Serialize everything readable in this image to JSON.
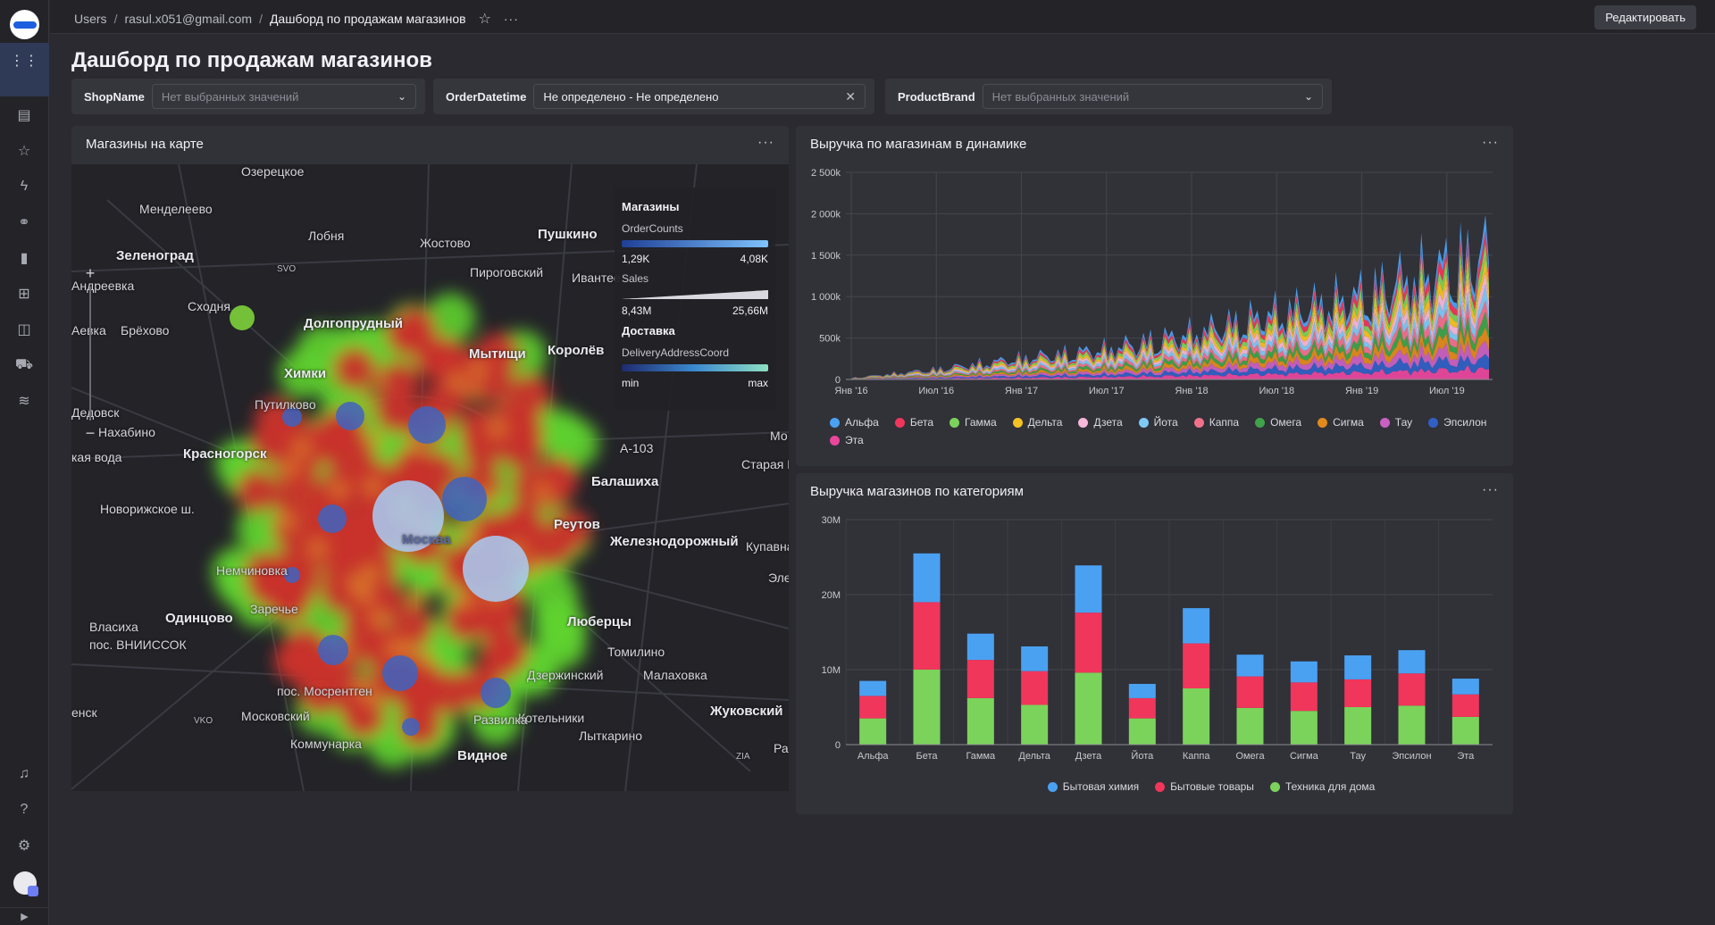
{
  "breadcrumbs": [
    "Users",
    "rasul.x051@gmail.com",
    "Дашборд по продажам магазинов"
  ],
  "edit_button": "Редактировать",
  "page_title": "Дашборд по продажам магазинов",
  "filters": [
    {
      "label": "ShopName",
      "value": "Нет выбранных значений",
      "filled": false,
      "control": "chevron"
    },
    {
      "label": "OrderDatetime",
      "value": "Не определено - Не определено",
      "filled": true,
      "control": "clear"
    },
    {
      "label": "ProductBrand",
      "value": "Нет выбранных значений",
      "filled": false,
      "control": "chevron"
    }
  ],
  "map_widget": {
    "title": "Магазины на карте",
    "labels": [
      "Озерецкое",
      "Менделеево",
      "Лобня",
      "Жостово",
      "Пушкино",
      "Зеленоград",
      "Пирогов­ский",
      "Ивантее",
      "Андреевка",
      "SVO",
      "Сходня",
      "Долгопрудный",
      "Брёхово",
      "Мытищи",
      "Королёв",
      "Химки",
      "Путилково",
      "Дедовск",
      "Нахабино",
      "Красногорск",
      "Балашиха",
      "Старая К",
      "Мо",
      "A-103",
      "Реутов",
      "Железнодорожный",
      "Купавна",
      "Эле",
      "Новорижское ш.",
      "Немчиновка",
      "Заречье",
      "Одинцово",
      "Люберцы",
      "Власиха",
      "пос. ВНИИССОК",
      "Томилино",
      "Малаховка",
      "Дзержинский",
      "пос. Мосрентген",
      "Котельники",
      "Московский",
      "VKO",
      "Жуковский",
      "Развилка",
      "Лыткарино",
      "Коммунарка",
      "Видное",
      "ZIA",
      "Ра",
      "енск",
      "Аевка",
      "кая вода",
      "Москва"
    ],
    "legend": {
      "title1": "Магазины",
      "metric1": "OrderCounts",
      "range1": [
        "1,29K",
        "4,08K"
      ],
      "metric2": "Sales",
      "range2": [
        "8,43M",
        "25,66M"
      ],
      "title2": "Доставка",
      "metric3": "DeliveryAddressCoord",
      "range3": [
        "min",
        "max"
      ]
    }
  },
  "line_widget": {
    "title": "Выручка по магазинам в динамике"
  },
  "bar_widget": {
    "title": "Выручка магазинов по категориям"
  },
  "chart_data": [
    {
      "type": "area",
      "title": "Выручка по магазинам в динамике",
      "x_ticks": [
        "Янв '16",
        "Июл '16",
        "Янв '17",
        "Июл '17",
        "Янв '18",
        "Июл '18",
        "Янв '19",
        "Июл '19"
      ],
      "y_ticks": [
        "0",
        "500k",
        "1 000k",
        "1 500k",
        "2 000k",
        "2 500k"
      ],
      "ylim": [
        0,
        2500000
      ],
      "stacked": true,
      "series": [
        {
          "name": "Альфа",
          "color": "#4aa1f2"
        },
        {
          "name": "Бета",
          "color": "#f0365b"
        },
        {
          "name": "Гамма",
          "color": "#7cd35b"
        },
        {
          "name": "Дельта",
          "color": "#f5c223"
        },
        {
          "name": "Дзета",
          "color": "#f7b7d8"
        },
        {
          "name": "Йота",
          "color": "#7ec9f5"
        },
        {
          "name": "Каппа",
          "color": "#f1718c"
        },
        {
          "name": "Омега",
          "color": "#3ea34a"
        },
        {
          "name": "Сигма",
          "color": "#e08a1e"
        },
        {
          "name": "Тау",
          "color": "#c861c1"
        },
        {
          "name": "Эпсилон",
          "color": "#3160c4"
        },
        {
          "name": "Эта",
          "color": "#e8479b"
        }
      ],
      "total_peak_by_tick": [
        30000,
        200000,
        420000,
        600000,
        900000,
        1300000,
        1650000,
        2230000
      ]
    },
    {
      "type": "bar",
      "title": "Выручка магазинов по категориям",
      "categories": [
        "Альфа",
        "Бета",
        "Гамма",
        "Дельта",
        "Дзета",
        "Йота",
        "Каппа",
        "Омега",
        "Сигма",
        "Тау",
        "Эпсилон",
        "Эта"
      ],
      "y_ticks": [
        "0",
        "10M",
        "20M",
        "30M"
      ],
      "ylim": [
        0,
        30000000
      ],
      "series": [
        {
          "name": "Техника для дома",
          "color": "#7cd35b",
          "values": [
            3500000,
            10000000,
            6200000,
            5300000,
            9600000,
            3500000,
            7500000,
            4900000,
            4500000,
            5000000,
            5200000,
            3700000
          ]
        },
        {
          "name": "Бытовые товары",
          "color": "#f0365b",
          "values": [
            3000000,
            9000000,
            5100000,
            4500000,
            8000000,
            2700000,
            6000000,
            4200000,
            3800000,
            3700000,
            4300000,
            3000000
          ]
        },
        {
          "name": "Бытовая химия",
          "color": "#4aa1f2",
          "values": [
            2000000,
            6500000,
            3500000,
            3300000,
            6300000,
            1900000,
            4700000,
            2900000,
            2800000,
            3200000,
            3100000,
            2100000
          ]
        }
      ],
      "legend_order": [
        "Бытовая химия",
        "Бытовые товары",
        "Техника для дома"
      ]
    }
  ]
}
